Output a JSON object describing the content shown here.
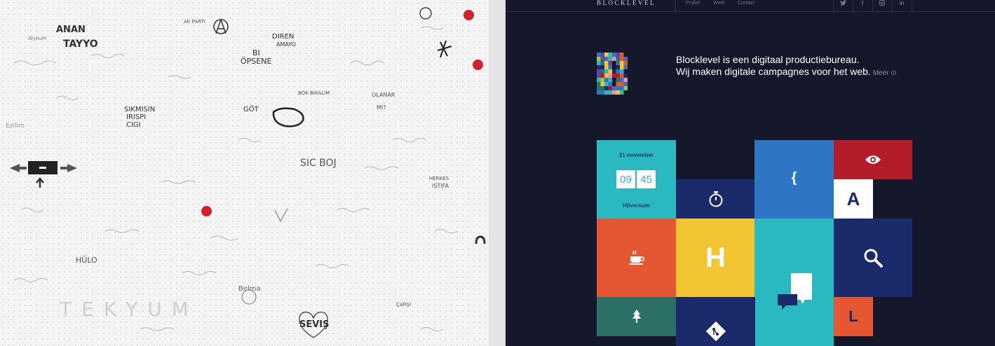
{
  "graffiti": {
    "texts": [
      "ANAN",
      "TAYYO",
      "DIREN",
      "AMAYO",
      "BI",
      "ÖPSENE",
      "SIKMISIN",
      "IRISPI",
      "CIGI",
      "GÖT",
      "HÜLO",
      "SEVIŞ",
      "TEKYUM",
      "SIC BOJ",
      "OLANAR",
      "MI?",
      "BOK BIKALIM",
      "HERKES",
      "ISTIFA",
      "Belma",
      "ÇARŞI",
      "AK PARTI",
      "Alyoum",
      "Ezilim"
    ],
    "marker_color": "#d3202a"
  },
  "site": {
    "logo": "BLOCKLEVEL",
    "nav": [
      "Profiel",
      "Werk",
      "Contact"
    ],
    "social_icons": [
      "twitter-icon",
      "facebook-icon",
      "instagram-icon",
      "linkedin-icon"
    ],
    "intro_line1": "Blocklevel is een digitaal productiebureau.",
    "intro_line2": "Wij maken digitale campagnes voor het web.",
    "more_link": "Meer ⊙",
    "date_tile": {
      "date": "21 november",
      "hour": "09",
      "minute": "45",
      "city": "Hilversum"
    },
    "tiles": {
      "brace": "{",
      "letter_a": "A",
      "letter_h": "H",
      "letter_l": "L"
    },
    "colors": {
      "background": "#15182a",
      "teal": "#2bb9c1",
      "navy": "#1b2a6a",
      "blue": "#2e76c3",
      "red": "#b51c2a",
      "orange": "#e55632",
      "yellow": "#f3c532",
      "green": "#2d7066",
      "white": "#ffffff"
    }
  }
}
